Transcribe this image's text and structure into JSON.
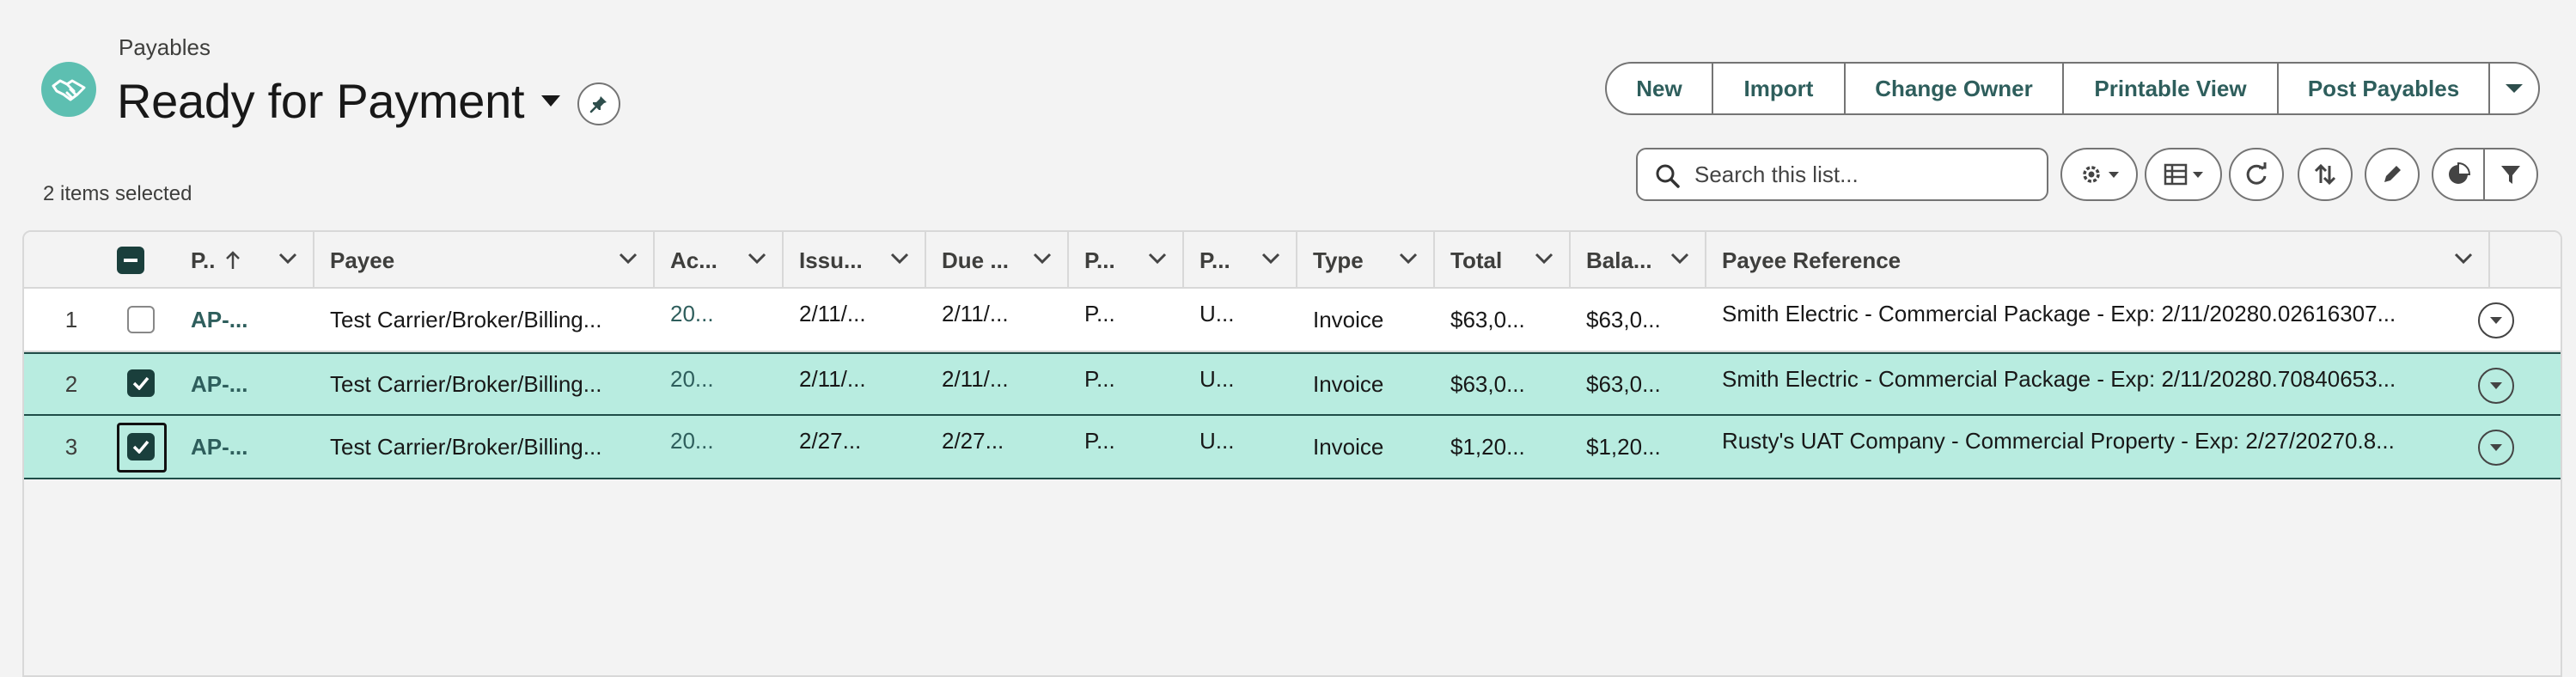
{
  "header": {
    "object_label": "Payables",
    "list_view_title": "Ready for Payment",
    "selected_count": "2 items selected"
  },
  "actions": {
    "new": "New",
    "import": "Import",
    "change_owner": "Change Owner",
    "printable_view": "Printable View",
    "post_payables": "Post Payables"
  },
  "search": {
    "placeholder": "Search this list...",
    "value": ""
  },
  "toolbar_icons": [
    "settings-icon",
    "table-view-icon",
    "refresh-icon",
    "sort-icon",
    "edit-icon",
    "chart-icon",
    "filter-icon"
  ],
  "columns": [
    "P..",
    "Payee",
    "Ac...",
    "Issu...",
    "Due ...",
    "P...",
    "P...",
    "Type",
    "Total",
    "Bala...",
    "Payee Reference"
  ],
  "rows": [
    {
      "num": "1",
      "selected": false,
      "name": "AP-...",
      "payee": "Test Carrier/Broker/Billing...",
      "account": "20...",
      "issue": "2/11/...",
      "due": "2/11/...",
      "p1": "P...",
      "p2": "U...",
      "type": "Invoice",
      "total": "$63,0...",
      "balance": "$63,0...",
      "reference": "Smith Electric - Commercial Package - Exp: 2/11/20280.02616307..."
    },
    {
      "num": "2",
      "selected": true,
      "name": "AP-...",
      "payee": "Test Carrier/Broker/Billing...",
      "account": "20...",
      "issue": "2/11/...",
      "due": "2/11/...",
      "p1": "P...",
      "p2": "U...",
      "type": "Invoice",
      "total": "$63,0...",
      "balance": "$63,0...",
      "reference": "Smith Electric - Commercial Package - Exp: 2/11/20280.70840653..."
    },
    {
      "num": "3",
      "selected": true,
      "name": "AP-...",
      "payee": "Test Carrier/Broker/Billing...",
      "account": "20...",
      "issue": "2/27...",
      "due": "2/27...",
      "p1": "P...",
      "p2": "U...",
      "type": "Invoice",
      "total": "$1,20...",
      "balance": "$1,20...",
      "reference": "Rusty's UAT Company - Commercial Property - Exp: 2/27/20270.8..."
    }
  ],
  "colors": {
    "brand": "#5dbfb1",
    "selected_row": "#b8ece0",
    "link": "#2e5e5c"
  }
}
